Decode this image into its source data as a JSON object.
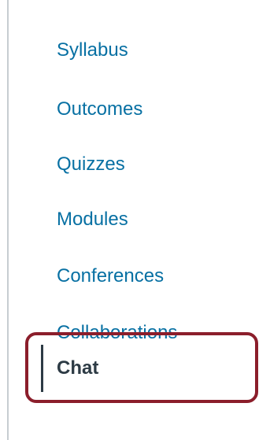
{
  "course_nav": {
    "items": [
      {
        "label": "Syllabus"
      },
      {
        "label": "Outcomes"
      },
      {
        "label": "Quizzes"
      },
      {
        "label": "Modules"
      },
      {
        "label": "Conferences"
      },
      {
        "label": "Collaborations"
      }
    ],
    "active_item": {
      "label": "Chat"
    }
  },
  "colors": {
    "link": "#0770a3",
    "active_text": "#2d3b45",
    "highlight_border": "#8b1e2b",
    "nav_border": "#c7cdd1"
  }
}
